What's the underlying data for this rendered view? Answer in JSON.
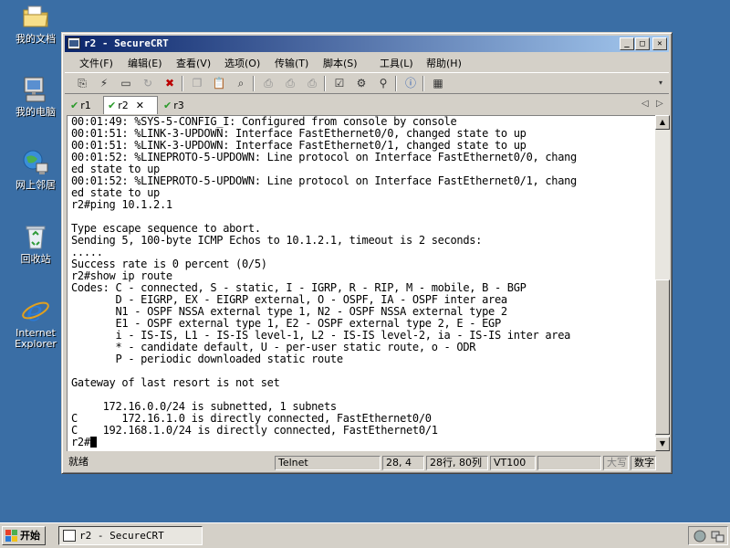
{
  "desktop": {
    "icons": [
      {
        "label": "我的文档"
      },
      {
        "label": "我的电脑"
      },
      {
        "label": "网上邻居"
      },
      {
        "label": "回收站"
      },
      {
        "label": "Internet Explorer"
      }
    ]
  },
  "window": {
    "title": "r2 - SecureCRT",
    "menu": [
      "文件(F)",
      "编辑(E)",
      "查看(V)",
      "选项(O)",
      "传输(T)",
      "脚本(S)",
      "工具(L)",
      "帮助(H)"
    ],
    "tabs": [
      {
        "label": "r1",
        "active": false
      },
      {
        "label": "r2",
        "active": true
      },
      {
        "label": "r3",
        "active": false
      }
    ]
  },
  "terminal": {
    "lines": [
      "00:01:49: %SYS-5-CONFIG_I: Configured from console by console",
      "00:01:51: %LINK-3-UPDOWN: Interface FastEthernet0/0, changed state to up",
      "00:01:51: %LINK-3-UPDOWN: Interface FastEthernet0/1, changed state to up",
      "00:01:52: %LINEPROTO-5-UPDOWN: Line protocol on Interface FastEthernet0/0, chang",
      "ed state to up",
      "00:01:52: %LINEPROTO-5-UPDOWN: Line protocol on Interface FastEthernet0/1, chang",
      "ed state to up",
      "r2#ping 10.1.2.1",
      "",
      "Type escape sequence to abort.",
      "Sending 5, 100-byte ICMP Echos to 10.1.2.1, timeout is 2 seconds:",
      ".....",
      "Success rate is 0 percent (0/5)",
      "r2#show ip route",
      "Codes: C - connected, S - static, I - IGRP, R - RIP, M - mobile, B - BGP",
      "       D - EIGRP, EX - EIGRP external, O - OSPF, IA - OSPF inter area",
      "       N1 - OSPF NSSA external type 1, N2 - OSPF NSSA external type 2",
      "       E1 - OSPF external type 1, E2 - OSPF external type 2, E - EGP",
      "       i - IS-IS, L1 - IS-IS level-1, L2 - IS-IS level-2, ia - IS-IS inter area",
      "       * - candidate default, U - per-user static route, o - ODR",
      "       P - periodic downloaded static route",
      "",
      "Gateway of last resort is not set",
      "",
      "     172.16.0.0/24 is subnetted, 1 subnets",
      "C       172.16.1.0 is directly connected, FastEthernet0/0",
      "C    192.168.1.0/24 is directly connected, FastEthernet0/1",
      "r2#"
    ]
  },
  "status": {
    "ready": "就绪",
    "protocol": "Telnet",
    "position": "28,  4",
    "size": "28行, 80列",
    "emulation": "VT100",
    "caps": "大写",
    "num": "数字"
  },
  "taskbar": {
    "start_label": "开始",
    "task_label": "r2 - SecureCRT"
  },
  "colors": {
    "desktop": "#3a6ea5",
    "titlebar_start": "#0a246a",
    "titlebar_end": "#a6caf0",
    "chrome": "#d4d0c8",
    "terminal_bg": "#ffffff"
  }
}
